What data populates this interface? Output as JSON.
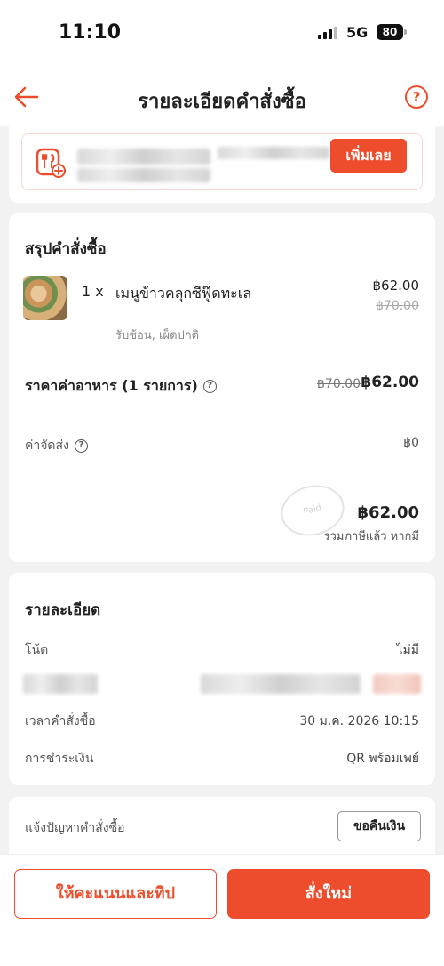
{
  "status_bar": {
    "time": "11:10",
    "network": "5G",
    "battery": "80"
  },
  "header": {
    "title": "รายละเอียดคำสั่งซื้อ",
    "help_label": "?"
  },
  "promo": {
    "button_label": "เพิ่มเลย"
  },
  "summary": {
    "title": "สรุปคำสั่งซื้อ",
    "item": {
      "qty": "1 x",
      "name": "เมนูข้าวคลุกซีฟู๊ดทะเล",
      "price": "฿62.00",
      "original_price": "฿70.00",
      "options": "รับช้อน, เผ็ดปกติ"
    },
    "food_label": "ราคาค่าอาหาร (1 รายการ)",
    "food_original": "฿70.00",
    "food_price": "฿62.00",
    "delivery_label": "ค่าจัดส่ง",
    "delivery_value": "฿0",
    "paid_stamp": "Paid",
    "total": "฿62.00",
    "total_note": "รวมภาษีแล้ว หากมี"
  },
  "details": {
    "title": "รายละเอียด",
    "note_label": "โน้ต",
    "note_value": "ไม่มี",
    "order_time_label": "เวลาคำสั่งซื้อ",
    "order_time_value": "30 ม.ค. 2026 10:15",
    "payment_label": "การชำระเงิน",
    "payment_value": "QR พร้อมเพย์"
  },
  "issue": {
    "label": "แจ้งปัญหาคำสั่งซื้อ",
    "refund_button": "ขอคืนเงิน"
  },
  "bottom": {
    "rate_button": "ให้คะแนนและทิป",
    "reorder_button": "สั่งใหม่"
  },
  "colors": {
    "accent": "#ee4d2d"
  }
}
